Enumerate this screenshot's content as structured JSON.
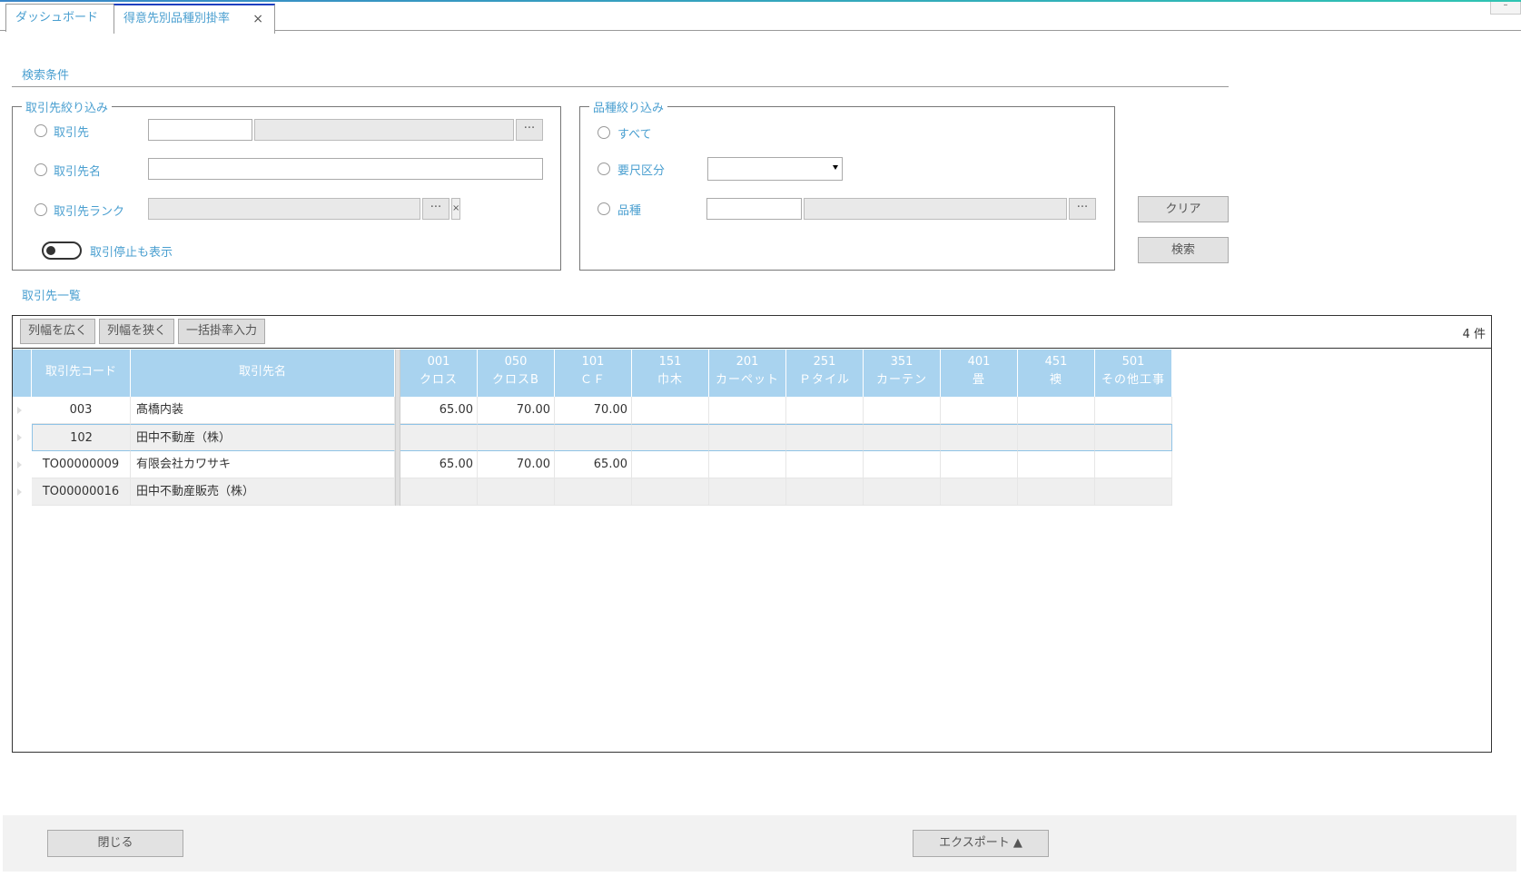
{
  "tabs": [
    {
      "label": "ダッシュボード"
    },
    {
      "label": "得意先別品種別掛率",
      "close": "×"
    }
  ],
  "window": {
    "minimize": "–"
  },
  "search_conditions": {
    "title": "検索条件",
    "customer_group": {
      "legend": "取引先絞り込み",
      "opt_customer": "取引先",
      "opt_customer_name": "取引先名",
      "opt_customer_rank": "取引先ランク",
      "show_stopped": "取引停止も表示",
      "ellipsis": "···",
      "clear_x": "×"
    },
    "product_group": {
      "legend": "品種絞り込み",
      "opt_all": "すべて",
      "opt_measure": "要尺区分",
      "opt_product": "品種",
      "ellipsis": "···"
    },
    "clear_label": "クリア",
    "search_label": "検索"
  },
  "list": {
    "title": "取引先一覧",
    "toolbar": {
      "widen": "列幅を広く",
      "narrow": "列幅を狭く",
      "bulk": "一括掛率入力",
      "count": "4 件"
    },
    "columns": [
      {
        "code": "",
        "name": "取引先コード"
      },
      {
        "code": "",
        "name": "取引先名"
      },
      {
        "code": "001",
        "name": "クロス"
      },
      {
        "code": "050",
        "name": "クロスB"
      },
      {
        "code": "101",
        "name": "ＣＦ"
      },
      {
        "code": "151",
        "name": "巾木"
      },
      {
        "code": "201",
        "name": "カーペット"
      },
      {
        "code": "251",
        "name": "Ｐタイル"
      },
      {
        "code": "351",
        "name": "カーテン"
      },
      {
        "code": "401",
        "name": "畳"
      },
      {
        "code": "451",
        "name": "襖"
      },
      {
        "code": "501",
        "name": "その他工事"
      }
    ],
    "rows": [
      {
        "code": "003",
        "name": "髙橋内装",
        "c001": "65.00",
        "c050": "70.00",
        "c101": "70.00"
      },
      {
        "code": "102",
        "name": "田中不動産（株）",
        "c001": "",
        "c050": "",
        "c101": ""
      },
      {
        "code": "TO00000009",
        "name": "有限会社カワサキ",
        "c001": "65.00",
        "c050": "70.00",
        "c101": "65.00"
      },
      {
        "code": "TO00000016",
        "name": "田中不動産販売（株）",
        "c001": "",
        "c050": "",
        "c101": ""
      }
    ]
  },
  "footer": {
    "close_label": "閉じる",
    "export_label": "エクスポート ▲"
  }
}
